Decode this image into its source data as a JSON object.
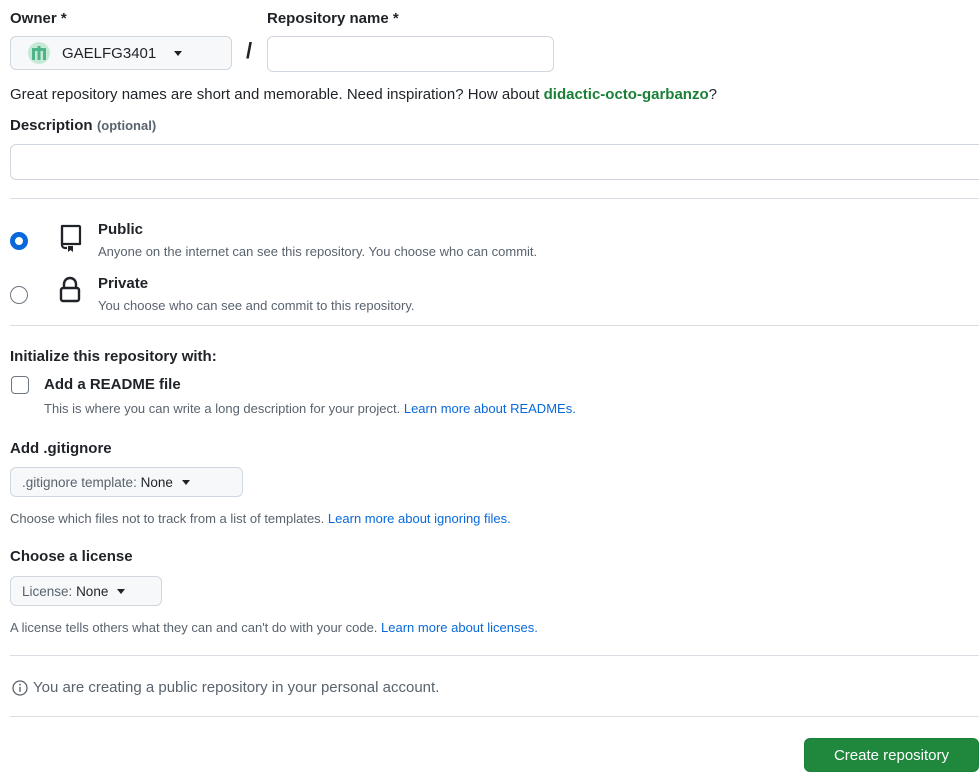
{
  "owner": {
    "label": "Owner *",
    "name": "GAELFG3401"
  },
  "repo": {
    "label": "Repository name *",
    "slash": "/",
    "value": ""
  },
  "hint": {
    "text": "Great repository names are short and memorable. Need inspiration? How about ",
    "suggestion": "didactic-octo-garbanzo",
    "end": "?"
  },
  "description": {
    "label": "Description",
    "optional": "(optional)",
    "value": ""
  },
  "visibility": {
    "public": {
      "label": "Public",
      "desc": "Anyone on the internet can see this repository. You choose who can commit.",
      "selected": true
    },
    "private": {
      "label": "Private",
      "desc": "You choose who can see and commit to this repository.",
      "selected": false
    }
  },
  "init": {
    "heading": "Initialize this repository with:",
    "readme_label": "Add a README file",
    "readme_desc": "This is where you can write a long description for your project. ",
    "readme_link": "Learn more about READMEs.",
    "readme_checked": false
  },
  "gitignore": {
    "heading": "Add .gitignore",
    "prefix": ".gitignore template:",
    "value": "None",
    "desc": "Choose which files not to track from a list of templates. ",
    "link": "Learn more about ignoring files."
  },
  "license": {
    "heading": "Choose a license",
    "prefix": "License:",
    "value": "None",
    "desc": "A license tells others what they can and can't do with your code. ",
    "link": "Learn more about licenses."
  },
  "notice": {
    "text": "You are creating a public repository in your personal account."
  },
  "submit": {
    "label": "Create repository"
  },
  "colors": {
    "accent": "#0969da",
    "success": "#1f883d",
    "suggestion": "#1a7f37"
  }
}
